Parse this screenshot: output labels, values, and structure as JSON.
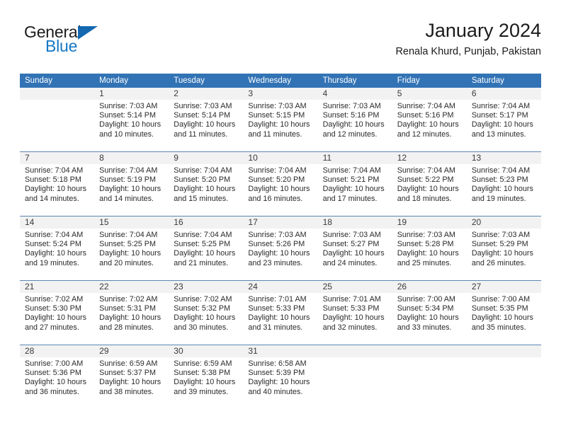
{
  "brand": {
    "name_part1": "General",
    "name_part2": "Blue"
  },
  "header": {
    "title": "January 2024",
    "subtitle": "Renala Khurd, Punjab, Pakistan"
  },
  "colors": {
    "header_blue": "#3273b5",
    "brand_blue": "#1577c4",
    "day_band_gray": "#f2f2f2",
    "row_divider": "#5b87b5"
  },
  "weekdays": [
    "Sunday",
    "Monday",
    "Tuesday",
    "Wednesday",
    "Thursday",
    "Friday",
    "Saturday"
  ],
  "weeks": [
    [
      {
        "day": "",
        "sunrise": "",
        "sunset": "",
        "daylight": ""
      },
      {
        "day": "1",
        "sunrise": "Sunrise: 7:03 AM",
        "sunset": "Sunset: 5:14 PM",
        "daylight": "Daylight: 10 hours and 10 minutes."
      },
      {
        "day": "2",
        "sunrise": "Sunrise: 7:03 AM",
        "sunset": "Sunset: 5:14 PM",
        "daylight": "Daylight: 10 hours and 11 minutes."
      },
      {
        "day": "3",
        "sunrise": "Sunrise: 7:03 AM",
        "sunset": "Sunset: 5:15 PM",
        "daylight": "Daylight: 10 hours and 11 minutes."
      },
      {
        "day": "4",
        "sunrise": "Sunrise: 7:03 AM",
        "sunset": "Sunset: 5:16 PM",
        "daylight": "Daylight: 10 hours and 12 minutes."
      },
      {
        "day": "5",
        "sunrise": "Sunrise: 7:04 AM",
        "sunset": "Sunset: 5:16 PM",
        "daylight": "Daylight: 10 hours and 12 minutes."
      },
      {
        "day": "6",
        "sunrise": "Sunrise: 7:04 AM",
        "sunset": "Sunset: 5:17 PM",
        "daylight": "Daylight: 10 hours and 13 minutes."
      }
    ],
    [
      {
        "day": "7",
        "sunrise": "Sunrise: 7:04 AM",
        "sunset": "Sunset: 5:18 PM",
        "daylight": "Daylight: 10 hours and 14 minutes."
      },
      {
        "day": "8",
        "sunrise": "Sunrise: 7:04 AM",
        "sunset": "Sunset: 5:19 PM",
        "daylight": "Daylight: 10 hours and 14 minutes."
      },
      {
        "day": "9",
        "sunrise": "Sunrise: 7:04 AM",
        "sunset": "Sunset: 5:20 PM",
        "daylight": "Daylight: 10 hours and 15 minutes."
      },
      {
        "day": "10",
        "sunrise": "Sunrise: 7:04 AM",
        "sunset": "Sunset: 5:20 PM",
        "daylight": "Daylight: 10 hours and 16 minutes."
      },
      {
        "day": "11",
        "sunrise": "Sunrise: 7:04 AM",
        "sunset": "Sunset: 5:21 PM",
        "daylight": "Daylight: 10 hours and 17 minutes."
      },
      {
        "day": "12",
        "sunrise": "Sunrise: 7:04 AM",
        "sunset": "Sunset: 5:22 PM",
        "daylight": "Daylight: 10 hours and 18 minutes."
      },
      {
        "day": "13",
        "sunrise": "Sunrise: 7:04 AM",
        "sunset": "Sunset: 5:23 PM",
        "daylight": "Daylight: 10 hours and 19 minutes."
      }
    ],
    [
      {
        "day": "14",
        "sunrise": "Sunrise: 7:04 AM",
        "sunset": "Sunset: 5:24 PM",
        "daylight": "Daylight: 10 hours and 19 minutes."
      },
      {
        "day": "15",
        "sunrise": "Sunrise: 7:04 AM",
        "sunset": "Sunset: 5:25 PM",
        "daylight": "Daylight: 10 hours and 20 minutes."
      },
      {
        "day": "16",
        "sunrise": "Sunrise: 7:04 AM",
        "sunset": "Sunset: 5:25 PM",
        "daylight": "Daylight: 10 hours and 21 minutes."
      },
      {
        "day": "17",
        "sunrise": "Sunrise: 7:03 AM",
        "sunset": "Sunset: 5:26 PM",
        "daylight": "Daylight: 10 hours and 23 minutes."
      },
      {
        "day": "18",
        "sunrise": "Sunrise: 7:03 AM",
        "sunset": "Sunset: 5:27 PM",
        "daylight": "Daylight: 10 hours and 24 minutes."
      },
      {
        "day": "19",
        "sunrise": "Sunrise: 7:03 AM",
        "sunset": "Sunset: 5:28 PM",
        "daylight": "Daylight: 10 hours and 25 minutes."
      },
      {
        "day": "20",
        "sunrise": "Sunrise: 7:03 AM",
        "sunset": "Sunset: 5:29 PM",
        "daylight": "Daylight: 10 hours and 26 minutes."
      }
    ],
    [
      {
        "day": "21",
        "sunrise": "Sunrise: 7:02 AM",
        "sunset": "Sunset: 5:30 PM",
        "daylight": "Daylight: 10 hours and 27 minutes."
      },
      {
        "day": "22",
        "sunrise": "Sunrise: 7:02 AM",
        "sunset": "Sunset: 5:31 PM",
        "daylight": "Daylight: 10 hours and 28 minutes."
      },
      {
        "day": "23",
        "sunrise": "Sunrise: 7:02 AM",
        "sunset": "Sunset: 5:32 PM",
        "daylight": "Daylight: 10 hours and 30 minutes."
      },
      {
        "day": "24",
        "sunrise": "Sunrise: 7:01 AM",
        "sunset": "Sunset: 5:33 PM",
        "daylight": "Daylight: 10 hours and 31 minutes."
      },
      {
        "day": "25",
        "sunrise": "Sunrise: 7:01 AM",
        "sunset": "Sunset: 5:33 PM",
        "daylight": "Daylight: 10 hours and 32 minutes."
      },
      {
        "day": "26",
        "sunrise": "Sunrise: 7:00 AM",
        "sunset": "Sunset: 5:34 PM",
        "daylight": "Daylight: 10 hours and 33 minutes."
      },
      {
        "day": "27",
        "sunrise": "Sunrise: 7:00 AM",
        "sunset": "Sunset: 5:35 PM",
        "daylight": "Daylight: 10 hours and 35 minutes."
      }
    ],
    [
      {
        "day": "28",
        "sunrise": "Sunrise: 7:00 AM",
        "sunset": "Sunset: 5:36 PM",
        "daylight": "Daylight: 10 hours and 36 minutes."
      },
      {
        "day": "29",
        "sunrise": "Sunrise: 6:59 AM",
        "sunset": "Sunset: 5:37 PM",
        "daylight": "Daylight: 10 hours and 38 minutes."
      },
      {
        "day": "30",
        "sunrise": "Sunrise: 6:59 AM",
        "sunset": "Sunset: 5:38 PM",
        "daylight": "Daylight: 10 hours and 39 minutes."
      },
      {
        "day": "31",
        "sunrise": "Sunrise: 6:58 AM",
        "sunset": "Sunset: 5:39 PM",
        "daylight": "Daylight: 10 hours and 40 minutes."
      },
      {
        "day": "",
        "sunrise": "",
        "sunset": "",
        "daylight": ""
      },
      {
        "day": "",
        "sunrise": "",
        "sunset": "",
        "daylight": ""
      },
      {
        "day": "",
        "sunrise": "",
        "sunset": "",
        "daylight": ""
      }
    ]
  ]
}
